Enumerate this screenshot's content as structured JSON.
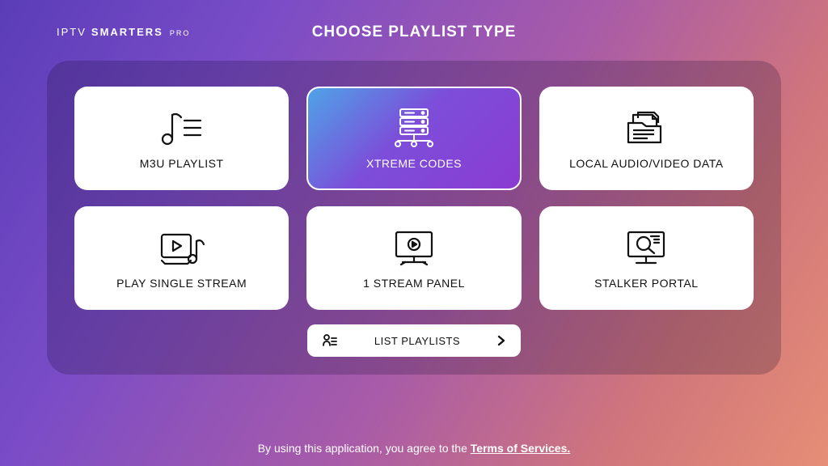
{
  "header": {
    "logo_prefix": "IPTV",
    "logo_main": "SMARTERS",
    "logo_suffix": "PRO",
    "title": "CHOOSE PLAYLIST TYPE"
  },
  "cards": {
    "m3u": {
      "label": "M3U PLAYLIST"
    },
    "xtreme": {
      "label": "XTREME CODES"
    },
    "local": {
      "label": "LOCAL AUDIO/VIDEO DATA"
    },
    "single": {
      "label": "PLAY SINGLE STREAM"
    },
    "onestream": {
      "label": "1 STREAM PANEL"
    },
    "stalker": {
      "label": "STALKER PORTAL"
    }
  },
  "list_button": {
    "label": "LIST PLAYLISTS"
  },
  "footer": {
    "prefix": "By using this application, you agree to the ",
    "link": "Terms of Services."
  }
}
